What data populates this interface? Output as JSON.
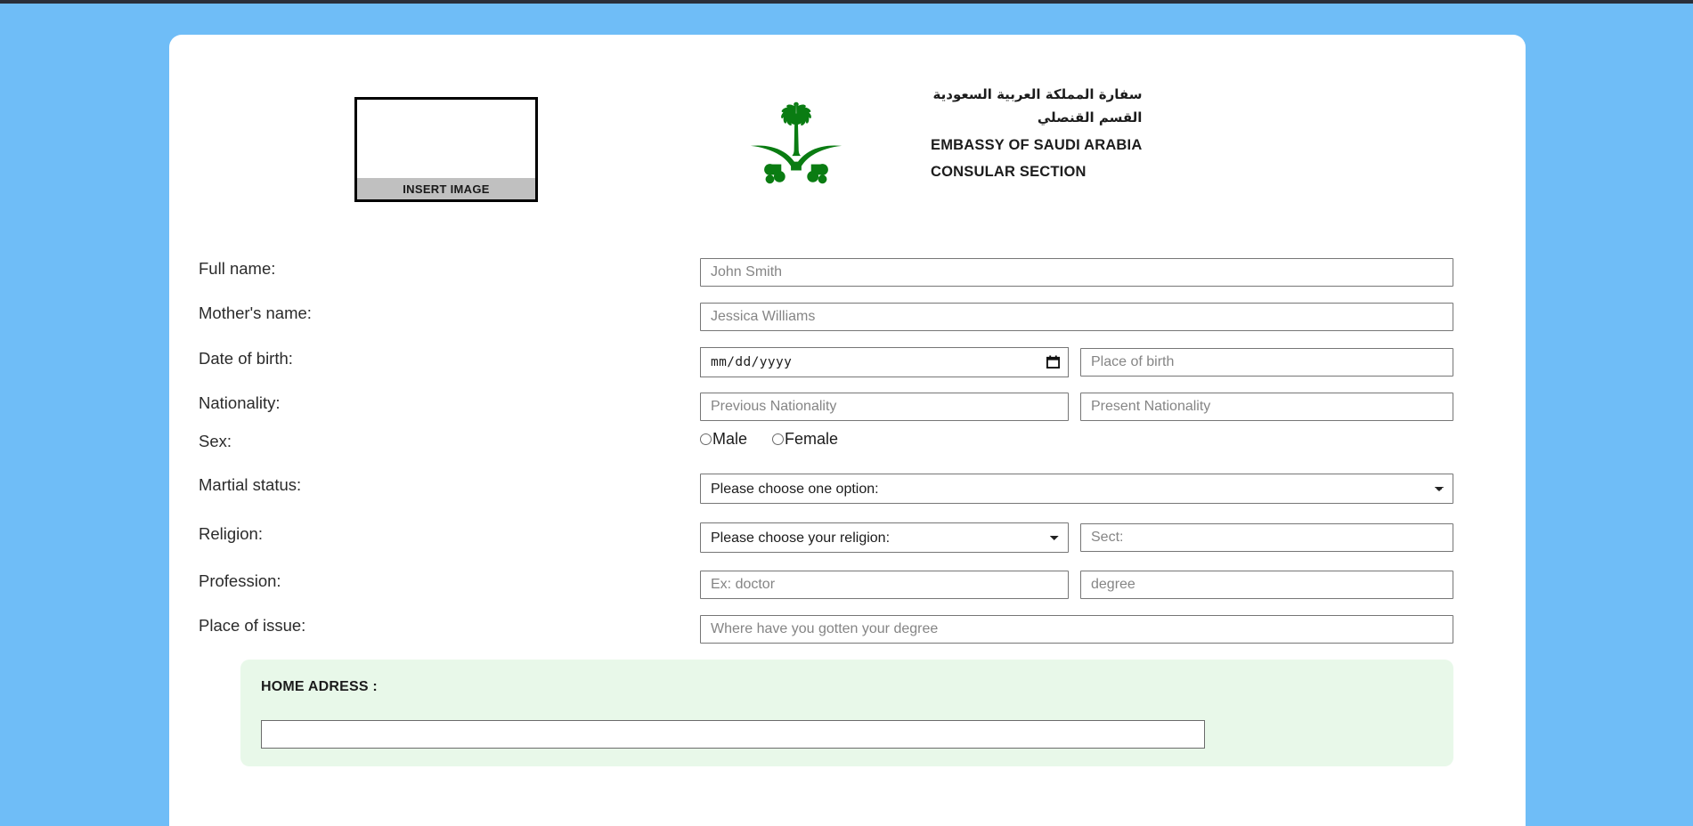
{
  "theme": {
    "page_background": "#6fbdf7",
    "card_background": "#ffffff",
    "emblem_color": "#0a7c12",
    "panel_background": "#e8f8e9",
    "field_border": "#767676",
    "placeholder_color": "#858585"
  },
  "header": {
    "photo_placeholder_label": "INSERT IMAGE",
    "emblem_name": "saudi-national-emblem",
    "org_arabic_line1": "سفارة المملكة العربية السعودية",
    "org_arabic_line2": "القسم القنصلي",
    "org_english_line1": "EMBASSY OF SAUDI ARABIA",
    "org_english_line2": "CONSULAR SECTION"
  },
  "form": {
    "labels": {
      "full_name": "Full name:",
      "mothers_name": "Mother's name:",
      "date_of_birth": "Date of birth:",
      "nationality": "Nationality:",
      "sex": "Sex:",
      "martial_status": "Martial status:",
      "religion": "Religion:",
      "profession": "Profession:",
      "place_of_issue": "Place of issue:"
    },
    "fields": {
      "full_name_placeholder": "John Smith",
      "full_name_value": "",
      "mothers_name_placeholder": "Jessica Williams",
      "mothers_name_value": "",
      "date_of_birth_value": "mm/dd/yyyy",
      "place_of_birth_placeholder": "Place of birth",
      "place_of_birth_value": "",
      "previous_nationality_placeholder": "Previous Nationality",
      "previous_nationality_value": "",
      "present_nationality_placeholder": "Present Nationality",
      "present_nationality_value": "",
      "sect_placeholder": "Sect:",
      "sect_value": "",
      "profession_placeholder": "Ex: doctor",
      "profession_value": "",
      "degree_placeholder": "degree",
      "degree_value": "",
      "place_of_issue_placeholder": "Where have you gotten your degree",
      "place_of_issue_value": ""
    },
    "sex_options": [
      {
        "label": "Male",
        "selected": false
      },
      {
        "label": "Female",
        "selected": false
      }
    ],
    "martial_status": {
      "selected": "Please choose one option:",
      "options": [
        "Please choose one option:"
      ]
    },
    "religion": {
      "selected": "Please choose your religion:",
      "options": [
        "Please choose your religion:"
      ]
    }
  },
  "address_section": {
    "title": "HOME ADRESS :",
    "input_value": "",
    "input_placeholder": ""
  }
}
